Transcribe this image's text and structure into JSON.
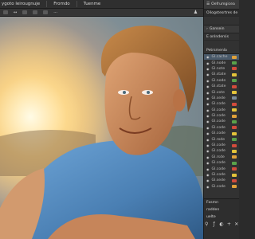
{
  "menubar": {
    "doc_title": "ygoto leirougnuje",
    "tab_a": "Fromdo",
    "tab_b": "Tuenme",
    "right_label": "Oefrumgicea"
  },
  "options": {
    "item1": "▢",
    "item2": "↔",
    "item3": "⋯"
  },
  "panel": {
    "top_title": "Oefrumgicea",
    "header_line": "Oilogstesrtres de",
    "section_general": "Gansein",
    "sub_general": "E onlndersis",
    "section_layers": "Petrsmenla",
    "layers": [
      {
        "label": "Gl.cache",
        "color": "#e0a13a"
      },
      {
        "label": "Gl.node",
        "color": "#5aa24a"
      },
      {
        "label": "Gl.note",
        "color": "#d24b3c"
      },
      {
        "label": "Gl.state",
        "color": "#e3c33a"
      },
      {
        "label": "Gl.node",
        "color": "#5aa24a"
      },
      {
        "label": "Gl.state",
        "color": "#d24b3c"
      },
      {
        "label": "Gl.vote",
        "color": "#e3c33a"
      },
      {
        "label": "Gl.sede",
        "color": "#7b8b9a"
      },
      {
        "label": "Gl.code",
        "color": "#d24b3c"
      },
      {
        "label": "Gl.code",
        "color": "#e3c33a"
      },
      {
        "label": "Gl.code",
        "color": "#e0a13a"
      },
      {
        "label": "Gl.code",
        "color": "#5aa24a"
      },
      {
        "label": "Gl.code",
        "color": "#d24b3c"
      },
      {
        "label": "Gl.code",
        "color": "#e3c33a"
      },
      {
        "label": "Gl.rode",
        "color": "#5aa24a"
      },
      {
        "label": "Gl.code",
        "color": "#d24b3c"
      },
      {
        "label": "Gl.code",
        "color": "#e3c33a"
      },
      {
        "label": "Gl.rsde",
        "color": "#e0a13a"
      },
      {
        "label": "Gl.code",
        "color": "#5aa24a"
      },
      {
        "label": "Gl.code",
        "color": "#d24b3c"
      },
      {
        "label": "Gl.code",
        "color": "#e3c33a"
      },
      {
        "label": "Gl.sede",
        "color": "#d24b3c"
      },
      {
        "label": "Gl.code",
        "color": "#e0a13a"
      }
    ],
    "footer_label": "Fosmn",
    "footer_line1": "radden",
    "footer_line2": "uelte"
  }
}
